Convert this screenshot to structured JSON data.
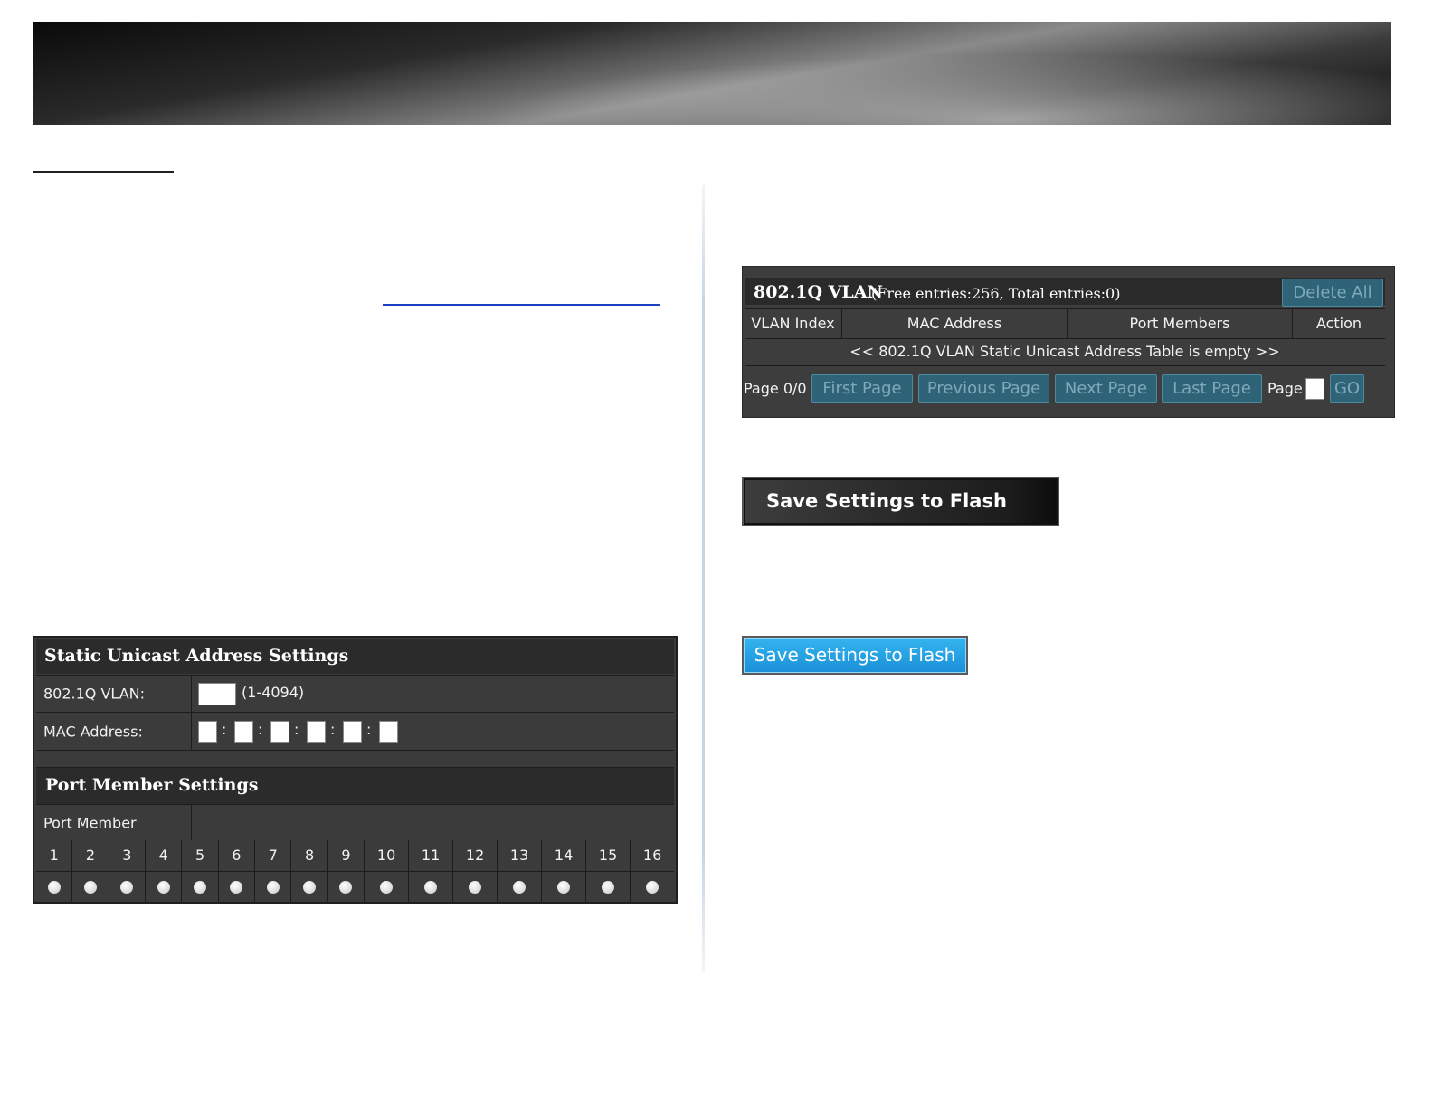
{
  "static_unicast": {
    "title": "Static Unicast Address Settings",
    "vlan_label": "802.1Q VLAN:",
    "vlan_value": "",
    "vlan_range": "(1-4094)",
    "mac_label": "MAC Address:",
    "mac_octets": [
      "",
      "",
      "",
      "",
      "",
      ""
    ],
    "mac_separator": ":"
  },
  "port_member": {
    "title": "Port Member Settings",
    "label": "Port Member",
    "ports": [
      "1",
      "2",
      "3",
      "4",
      "5",
      "6",
      "7",
      "8",
      "9",
      "10",
      "11",
      "12",
      "13",
      "14",
      "15",
      "16"
    ]
  },
  "vlan_table": {
    "title": "802.1Q VLAN",
    "subtitle": "(Free entries:256, Total entries:0)",
    "delete_all": "Delete All",
    "columns": [
      "VLAN Index",
      "MAC Address",
      "Port Members",
      "Action"
    ],
    "empty_message": "<< 802.1Q VLAN Static Unicast Address Table is empty >>",
    "page_status": "Page 0/0",
    "first_page": "First Page",
    "previous_page": "Previous Page",
    "next_page": "Next Page",
    "last_page": "Last Page",
    "page_label": "Page",
    "page_input": "",
    "go": "GO"
  },
  "save_dark": {
    "label": "Save Settings to Flash"
  },
  "save_blue": {
    "label": "Save Settings to Flash"
  },
  "colors": {
    "panel_bg": "#3b3b3b",
    "panel_header": "#2b2b2b",
    "disabled_button": "#2f6478",
    "save_blue": "#1a8fd6",
    "footer_rule": "#3a86c8"
  }
}
